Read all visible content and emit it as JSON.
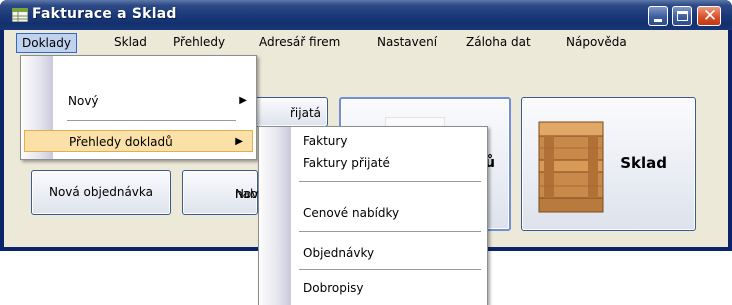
{
  "window": {
    "title": "Fakturace a Sklad",
    "title_bar_color": "#1c3a7a",
    "close_button_color": "#d9512a"
  },
  "menubar": {
    "items": [
      {
        "label": "Doklady",
        "state": "open"
      },
      {
        "label": "Sklad"
      },
      {
        "label": "Přehledy"
      },
      {
        "label": "Adresář firem"
      },
      {
        "label": "Nastavení"
      },
      {
        "label": "Záloha dat"
      },
      {
        "label": "Nápověda"
      }
    ]
  },
  "doklady_menu": {
    "items": [
      {
        "label": "Nový",
        "has_submenu": true
      },
      {
        "label": "Přehledy dokladů",
        "has_submenu": true,
        "highlighted": true
      }
    ]
  },
  "prehledy_submenu": {
    "items": [
      {
        "label": "Faktury"
      },
      {
        "label": "Faktury přijaté"
      },
      {
        "label": "Cenové nabídky"
      },
      {
        "label": "Objednávky"
      },
      {
        "label": "Dobropisy"
      }
    ]
  },
  "buttons": {
    "prijata_partial": "řijatá",
    "doklady_partial": "ů",
    "sklad": "Sklad",
    "nova_objednavka": "Nová objednávka",
    "nova_nabidka_line1": "Nová c",
    "nova_nabidka_line2": "nabí"
  },
  "icons": {
    "app": "table-icon",
    "doklady": "document-icon",
    "sklad": "wooden-crate-icon",
    "submenu_arrow": "triangle-right-icon"
  }
}
